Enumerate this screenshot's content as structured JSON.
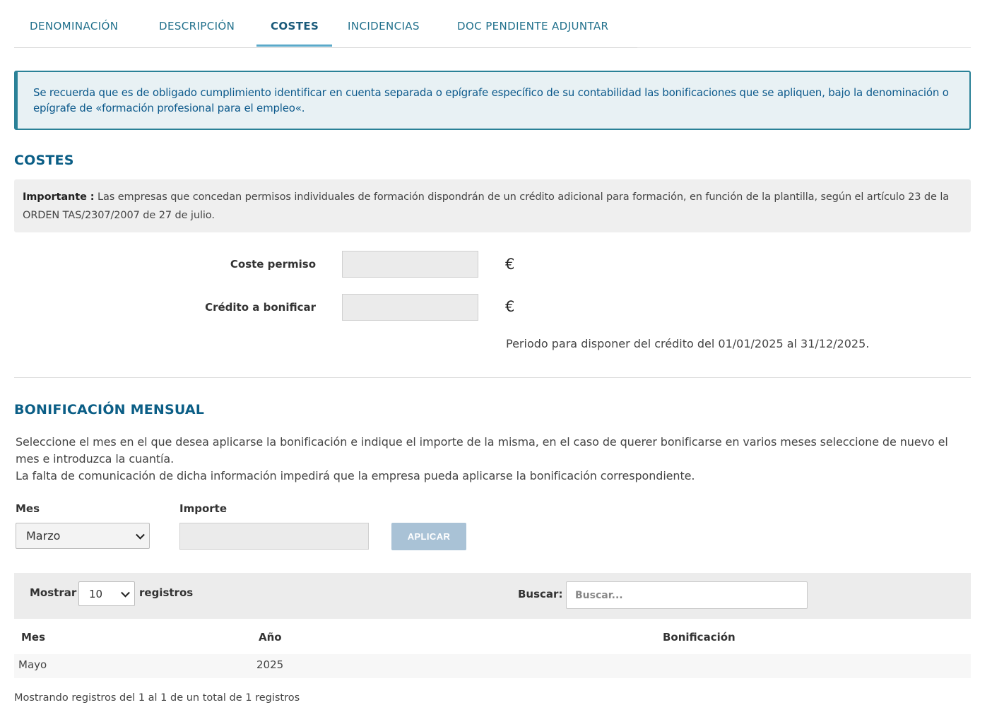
{
  "tabs": [
    {
      "label": "DENOMINACIÓN"
    },
    {
      "label": "DESCRIPCIÓN"
    },
    {
      "label": "COSTES"
    },
    {
      "label": "INCIDENCIAS"
    },
    {
      "label": "DOC PENDIENTE ADJUNTAR"
    }
  ],
  "active_tab": "COSTES",
  "alert": {
    "text": "Se recuerda que es de obligado cumplimiento identificar en cuenta separada o epígrafe específico de su contabilidad las bonificaciones que se apliquen, bajo la denominación o epígrafe de «formación profesional para el empleo«."
  },
  "costes": {
    "title": "COSTES",
    "info_strong": "Importante :",
    "info_text": " Las empresas que concedan permisos individuales de formación dispondrán de un crédito adicional para formación, en función de la plantilla, según el artículo 23 de la ORDEN TAS/2307/2007 de 27 de julio.",
    "coste_permiso_label": "Coste permiso",
    "coste_permiso_value": "",
    "credito_label": "Crédito a bonificar",
    "credito_value": "",
    "currency": "€",
    "period_text": "Periodo para disponer del crédito del 01/01/2025 al 31/12/2025."
  },
  "bonificacion": {
    "title": "BONIFICACIÓN MENSUAL",
    "desc_line1": "Seleccione el mes en el que desea aplicarse la bonificación e indique el importe de la misma, en el caso de querer bonificarse en varios meses seleccione de nuevo el mes e introduzca la cuantía.",
    "desc_line2": "La falta de comunicación de dicha información impedirá que la empresa pueda aplicarse la bonificación correspondiente.",
    "mes_label": "Mes",
    "mes_selected": "Marzo",
    "importe_label": "Importe",
    "importe_value": "",
    "apply_label": "APLICAR"
  },
  "table": {
    "show_label": "Mostrar",
    "page_size": "10",
    "records_label": "registros",
    "search_label": "Buscar:",
    "search_placeholder": "Buscar...",
    "headers": [
      "Mes",
      "Año",
      "Bonificación"
    ],
    "rows": [
      {
        "mes": "Mayo",
        "anio": "2025",
        "bonificacion": ""
      }
    ],
    "footer": "Mostrando registros del 1 al 1 de un total de 1 registros"
  }
}
